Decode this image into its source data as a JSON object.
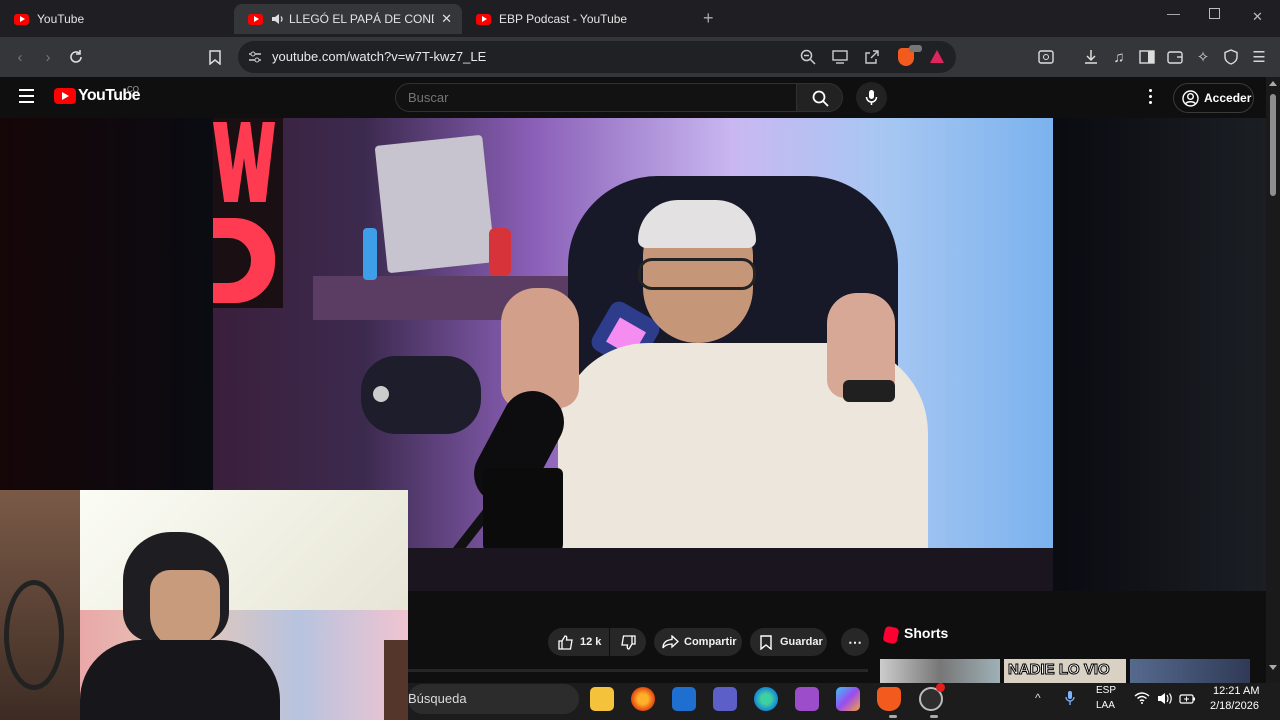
{
  "browser": {
    "tabs": [
      {
        "title": "YouTube"
      },
      {
        "title": "LLEGÓ EL PAPÁ DE CONDER |"
      },
      {
        "title": "EBP Podcast - YouTube"
      }
    ],
    "url": "youtube.com/watch?v=w7T-kwz7_LE"
  },
  "youtube": {
    "logo_text": "YouTube",
    "country_code": "CO",
    "search_placeholder": "Buscar",
    "signin_label": "Acceder",
    "actions": {
      "likes": "12 k",
      "share": "Compartir",
      "save": "Guardar"
    },
    "shorts_title": "Shorts",
    "shorts_preview_text": "NADIE LO VIO"
  },
  "taskbar": {
    "search_label": "Búsqueda",
    "lang_top": "ESP",
    "lang_bottom": "LAA",
    "time": "12:21 AM",
    "date": "2/18/2026"
  },
  "colors": {
    "yt_red": "#ff0000",
    "browser_dark": "#35363a",
    "page_bg": "#0f0f0f"
  }
}
